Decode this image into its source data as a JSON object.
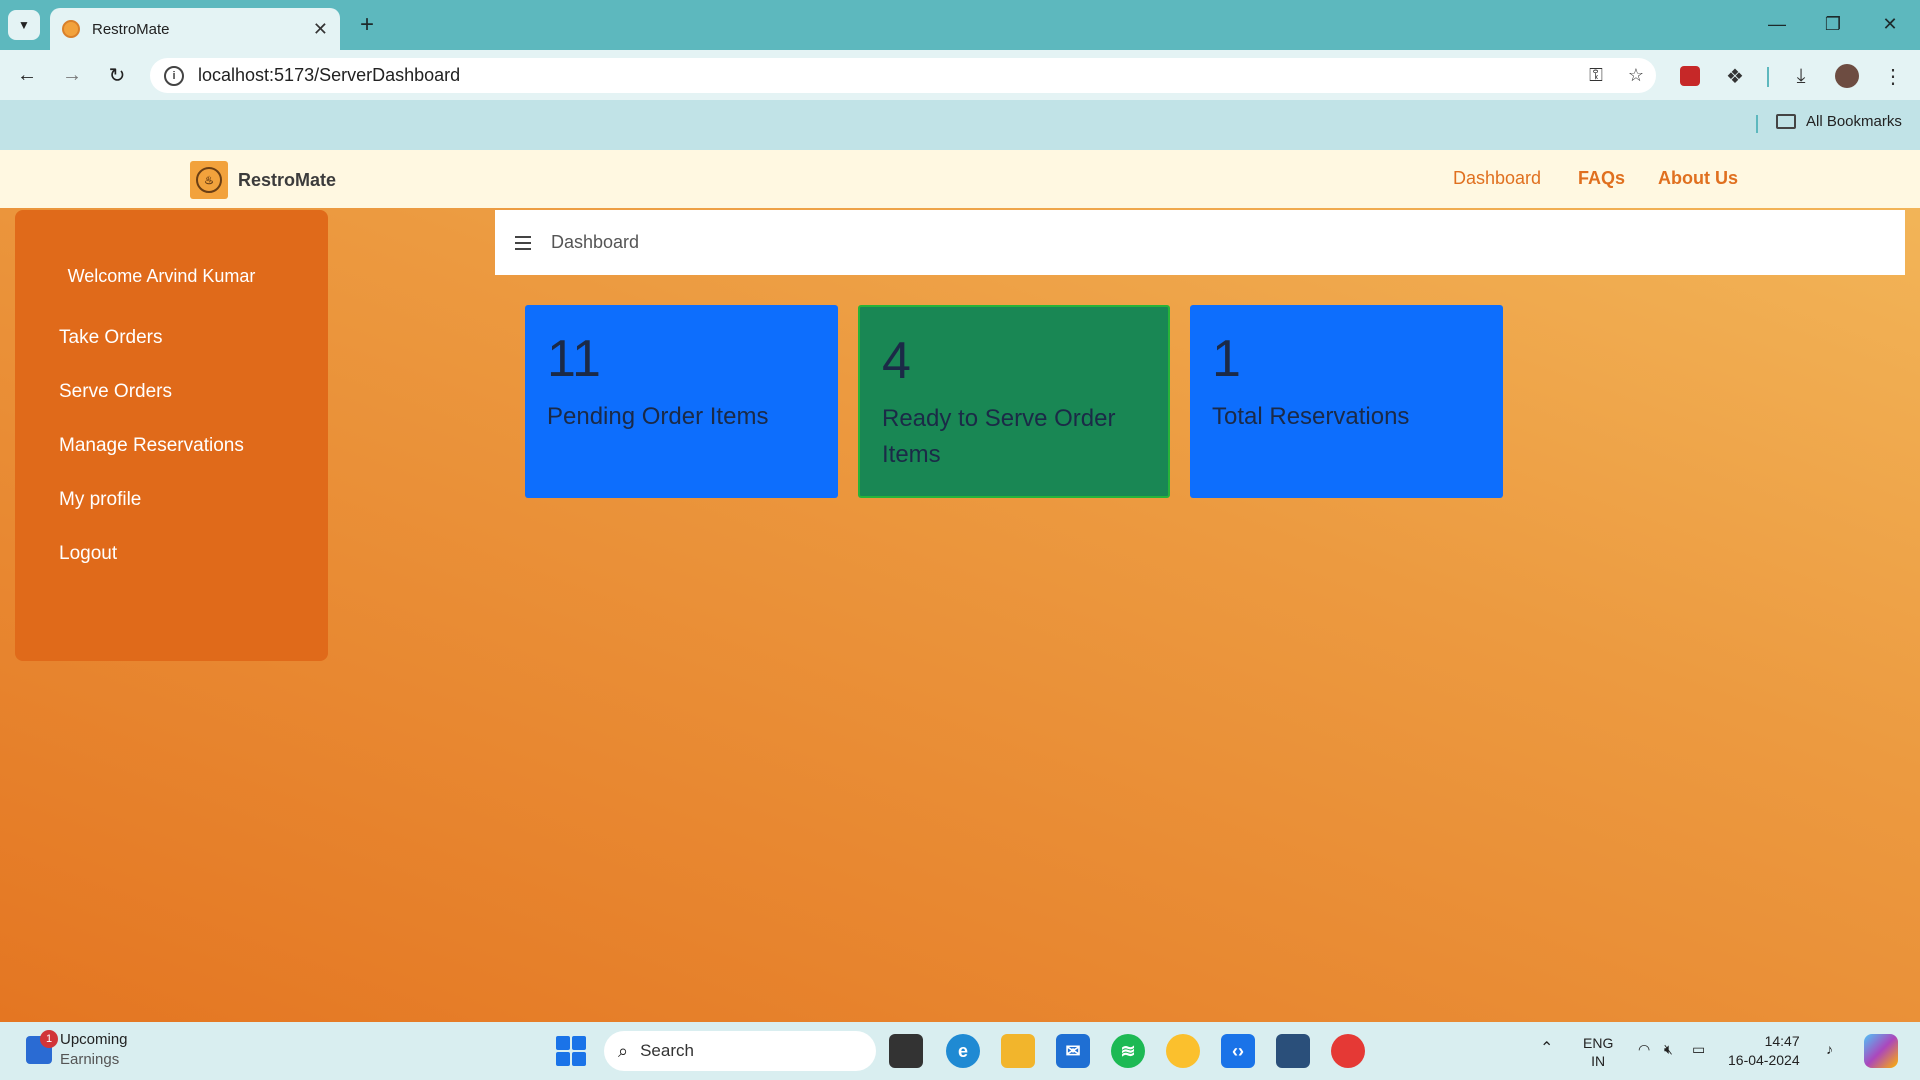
{
  "browser": {
    "tab_title": "RestroMate",
    "url": "localhost:5173/ServerDashboard",
    "bookmarks_label": "All Bookmarks"
  },
  "navbar": {
    "brand": "RestroMate",
    "links": [
      "Dashboard",
      "FAQs",
      "About Us"
    ]
  },
  "sidebar": {
    "welcome": "Welcome Arvind Kumar",
    "items": [
      "Take Orders",
      "Serve Orders",
      "Manage Reservations",
      "My profile",
      "Logout"
    ]
  },
  "topbar": {
    "title": "Dashboard"
  },
  "cards": [
    {
      "value": "11",
      "label": "Pending Order Items",
      "color": "#0d6efd"
    },
    {
      "value": "4",
      "label": "Ready to Serve Order Items",
      "color": "#198754"
    },
    {
      "value": "1",
      "label": "Total Reservations",
      "color": "#0d6efd"
    }
  ],
  "taskbar": {
    "weather_title": "Upcoming",
    "weather_sub": "Earnings",
    "weather_badge": "1",
    "search_placeholder": "Search",
    "lang_line1": "ENG",
    "lang_line2": "IN",
    "time": "14:47",
    "date": "16-04-2024"
  }
}
